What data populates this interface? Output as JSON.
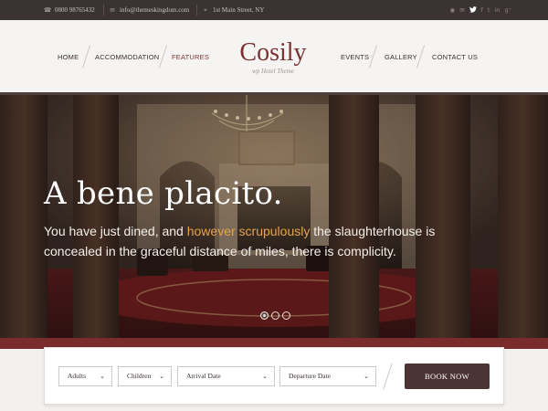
{
  "topbar": {
    "phone": "0800 98765432",
    "email": "info@themeskingdom.com",
    "address": "1st Main Street, NY",
    "socials": [
      "rss-icon",
      "email-icon",
      "twitter-icon",
      "facebook-icon",
      "tumblr-icon",
      "linkedin-icon",
      "googleplus-icon"
    ],
    "social_glyphs": [
      "◉",
      "✉",
      "🐦",
      "f",
      "t",
      "in",
      "g⁺"
    ]
  },
  "nav": {
    "left": [
      "HOME",
      "ACCOMMODATION",
      "FEATURES"
    ],
    "right": [
      "EVENTS",
      "GALLERY",
      "CONTACT US"
    ],
    "active": "FEATURES"
  },
  "logo": {
    "title": "Cosily",
    "subtitle": "wp Hotel Theme"
  },
  "hero": {
    "title": "A bene placito.",
    "text_before": "You have just dined, and ",
    "text_highlight": "however scrupulously",
    "text_after": " the slaughterhouse is concealed in the graceful distance of miles, there is complicity.",
    "slides": 3,
    "active_slide": 1
  },
  "booking": {
    "adults": "Adults",
    "children": "Children",
    "arrival": "Arrival Date",
    "departure": "Departure Date",
    "button": "BOOK NOW"
  },
  "colors": {
    "topbar": "#3b3333",
    "accent": "#7a3232",
    "highlight": "#e6a24d",
    "button": "#4d3434",
    "band": "#7a2c2c"
  }
}
